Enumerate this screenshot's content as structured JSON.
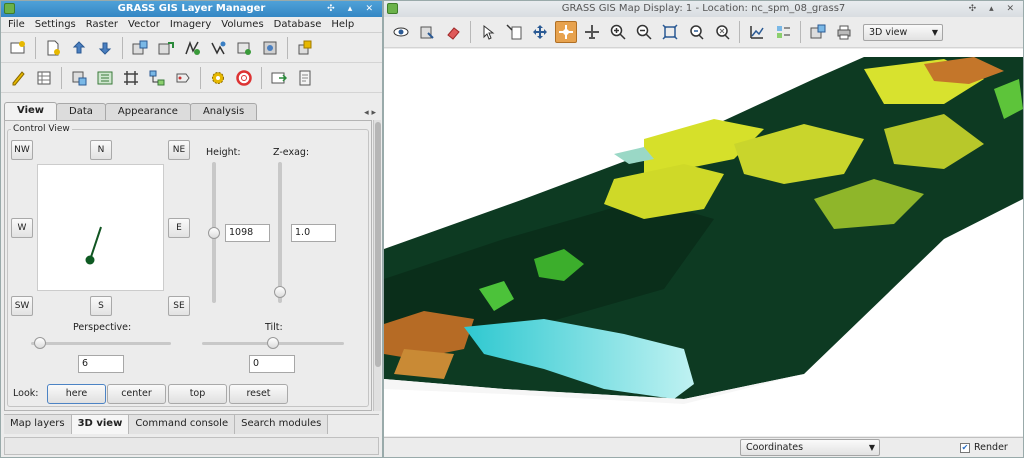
{
  "layer_manager": {
    "title": "GRASS GIS Layer Manager",
    "menu": [
      "File",
      "Settings",
      "Raster",
      "Vector",
      "Imagery",
      "Volumes",
      "Database",
      "Help"
    ],
    "tabs": [
      "View",
      "Data",
      "Appearance",
      "Analysis"
    ],
    "control_view": {
      "group_label": "Control View",
      "directions": {
        "nw": "NW",
        "n": "N",
        "ne": "NE",
        "w": "W",
        "e": "E",
        "sw": "SW",
        "s": "S",
        "se": "SE"
      },
      "height_label": "Height:",
      "height_value": "1098",
      "zexag_label": "Z-exag:",
      "zexag_value": "1.0",
      "perspective_label": "Perspective:",
      "perspective_value": "6",
      "tilt_label": "Tilt:",
      "tilt_value": "0",
      "look_label": "Look:",
      "look_buttons": [
        "here",
        "center",
        "top",
        "reset"
      ]
    },
    "bottom_tabs": [
      "Map layers",
      "3D view",
      "Command console",
      "Search modules"
    ]
  },
  "map_display": {
    "title": "GRASS GIS Map Display: 1  - Location: nc_spm_08_grass7",
    "view_mode": "3D view",
    "status_mode": "Coordinates",
    "render_label": "Render",
    "render_checked": true
  },
  "colors": {
    "title_active": "#3a8cc9",
    "tool_active": "#e7a24e",
    "forest": "#0f3b24",
    "canopy": "#d8e32a",
    "water": "#3fd4d8",
    "bare": "#c4762a"
  }
}
